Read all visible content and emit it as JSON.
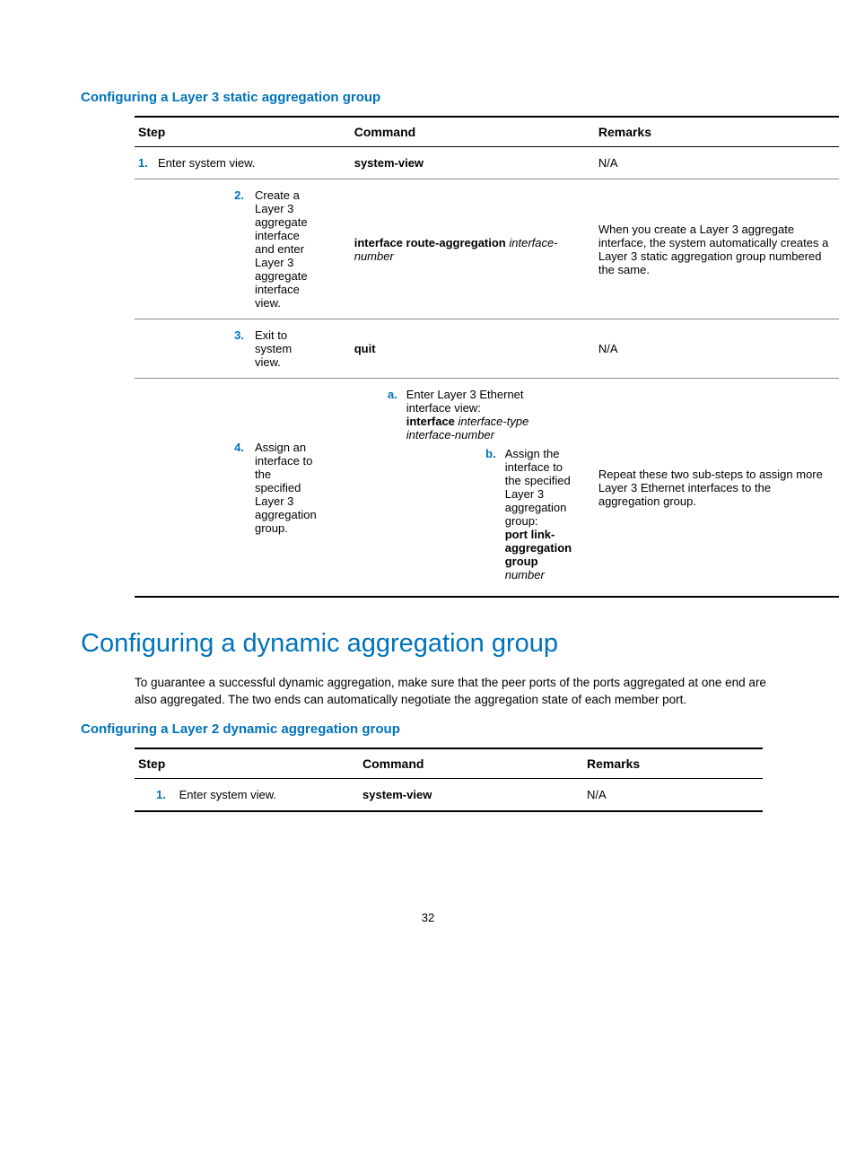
{
  "section1": {
    "subtitle": "Configuring a Layer 3 static aggregation group",
    "headers": {
      "step": "Step",
      "command": "Command",
      "remarks": "Remarks"
    },
    "rows": [
      {
        "num": "1.",
        "step": "Enter system view.",
        "command_bold": "system-view",
        "remarks": "N/A"
      },
      {
        "num": "2.",
        "step": "Create a Layer 3 aggregate interface and enter Layer 3 aggregate interface view.",
        "command_bold": "interface route-aggregation",
        "command_italic": "interface-number",
        "remarks": "When you create a Layer 3 aggregate interface, the system automatically creates a Layer 3 static aggregation group numbered the same."
      },
      {
        "num": "3.",
        "step": "Exit to system view.",
        "command_bold": "quit",
        "remarks": "N/A"
      },
      {
        "num": "4.",
        "step": "Assign an interface to the specified Layer 3 aggregation group.",
        "sub_a": {
          "letter": "a.",
          "text1": "Enter Layer 3 Ethernet interface view:",
          "bold": "interface",
          "italic1": "interface-type interface-number"
        },
        "sub_b": {
          "letter": "b.",
          "text1": "Assign the interface to the specified Layer 3 aggregation group:",
          "bold": "port link-aggregation group",
          "italic": "number"
        },
        "remarks": "Repeat these two sub-steps to assign more Layer 3 Ethernet interfaces to the aggregation group."
      }
    ]
  },
  "h2": "Configuring a dynamic aggregation group",
  "para": "To guarantee a successful dynamic aggregation, make sure that the peer ports of the ports aggregated at one end are also aggregated. The two ends can automatically negotiate the aggregation state of each member port.",
  "section2": {
    "subtitle": "Configuring a Layer 2 dynamic aggregation group",
    "headers": {
      "step": "Step",
      "command": "Command",
      "remarks": "Remarks"
    },
    "rows": [
      {
        "num": "1.",
        "step": "Enter system view.",
        "command_bold": "system-view",
        "remarks": "N/A"
      }
    ]
  },
  "page": "32"
}
